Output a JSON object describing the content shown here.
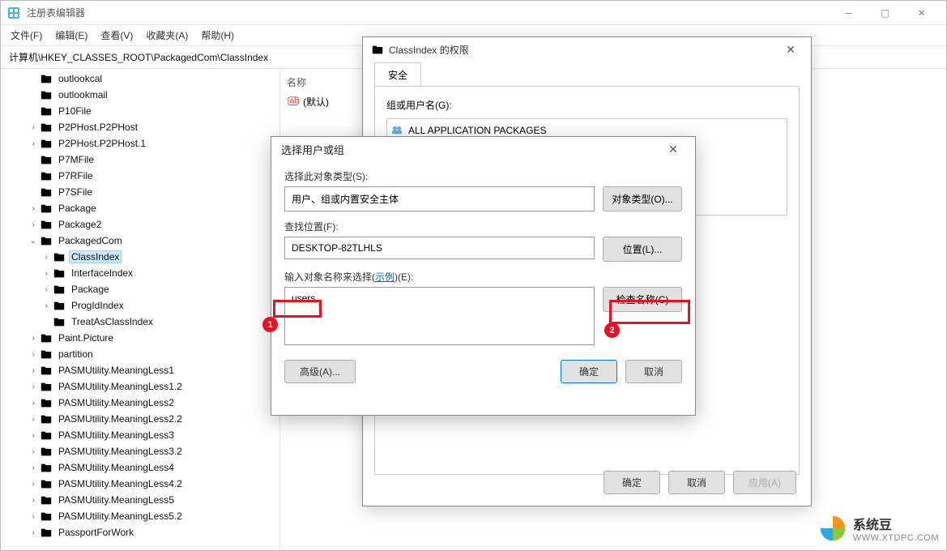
{
  "window": {
    "title": "注册表编辑器",
    "menus": {
      "file": "文件(F)",
      "edit": "编辑(E)",
      "view": "查看(V)",
      "favorites": "收藏夹(A)",
      "help": "帮助(H)"
    },
    "address": "计算机\\HKEY_CLASSES_ROOT\\PackagedCom\\ClassIndex"
  },
  "tree": [
    {
      "depth": 2,
      "exp": "",
      "label": "outlookcal"
    },
    {
      "depth": 2,
      "exp": "",
      "label": "outlookmail"
    },
    {
      "depth": 2,
      "exp": "",
      "label": "P10File"
    },
    {
      "depth": 2,
      "exp": ">",
      "label": "P2PHost.P2PHost"
    },
    {
      "depth": 2,
      "exp": ">",
      "label": "P2PHost.P2PHost.1"
    },
    {
      "depth": 2,
      "exp": "",
      "label": "P7MFile"
    },
    {
      "depth": 2,
      "exp": "",
      "label": "P7RFile"
    },
    {
      "depth": 2,
      "exp": "",
      "label": "P7SFile"
    },
    {
      "depth": 2,
      "exp": ">",
      "label": "Package"
    },
    {
      "depth": 2,
      "exp": ">",
      "label": "Package2"
    },
    {
      "depth": 2,
      "exp": "v",
      "label": "PackagedCom"
    },
    {
      "depth": 3,
      "exp": ">",
      "label": "ClassIndex",
      "selected": true
    },
    {
      "depth": 3,
      "exp": ">",
      "label": "InterfaceIndex"
    },
    {
      "depth": 3,
      "exp": ">",
      "label": "Package"
    },
    {
      "depth": 3,
      "exp": ">",
      "label": "ProgIdIndex"
    },
    {
      "depth": 3,
      "exp": "",
      "label": "TreatAsClassIndex"
    },
    {
      "depth": 2,
      "exp": ">",
      "label": "Paint.Picture"
    },
    {
      "depth": 2,
      "exp": ">",
      "label": "partition"
    },
    {
      "depth": 2,
      "exp": ">",
      "label": "PASMUtility.MeaningLess1"
    },
    {
      "depth": 2,
      "exp": ">",
      "label": "PASMUtility.MeaningLess1.2"
    },
    {
      "depth": 2,
      "exp": ">",
      "label": "PASMUtility.MeaningLess2"
    },
    {
      "depth": 2,
      "exp": ">",
      "label": "PASMUtility.MeaningLess2.2"
    },
    {
      "depth": 2,
      "exp": ">",
      "label": "PASMUtility.MeaningLess3"
    },
    {
      "depth": 2,
      "exp": ">",
      "label": "PASMUtility.MeaningLess3.2"
    },
    {
      "depth": 2,
      "exp": ">",
      "label": "PASMUtility.MeaningLess4"
    },
    {
      "depth": 2,
      "exp": ">",
      "label": "PASMUtility.MeaningLess4.2"
    },
    {
      "depth": 2,
      "exp": ">",
      "label": "PASMUtility.MeaningLess5"
    },
    {
      "depth": 2,
      "exp": ">",
      "label": "PASMUtility.MeaningLess5.2"
    },
    {
      "depth": 2,
      "exp": ">",
      "label": "PassportForWork"
    }
  ],
  "list": {
    "header": "名称",
    "default_row": "(默认)"
  },
  "perm_dialog": {
    "title": "ClassIndex 的权限",
    "tab": "安全",
    "group_label": "组或用户名(G):",
    "group_item": "ALL APPLICATION PACKAGES",
    "ok": "确定",
    "cancel": "取消",
    "apply": "应用(A)"
  },
  "select_dialog": {
    "title": "选择用户或组",
    "type_label": "选择此对象类型(S):",
    "type_value": "用户、组或内置安全主体",
    "type_btn": "对象类型(O)...",
    "loc_label": "查找位置(F):",
    "loc_value": "DESKTOP-82TLHLS",
    "loc_btn": "位置(L)...",
    "name_label_pre": "输入对象名称来选择(",
    "name_label_link": "示例",
    "name_label_post": ")(E):",
    "name_value": "users",
    "check_btn": "检查名称(C)",
    "advanced": "高级(A)...",
    "ok": "确定",
    "cancel": "取消"
  },
  "annotations": {
    "n1": "1",
    "n2": "2"
  },
  "watermark": {
    "name": "系统豆",
    "url": "WWW.XTDPC.COM"
  }
}
